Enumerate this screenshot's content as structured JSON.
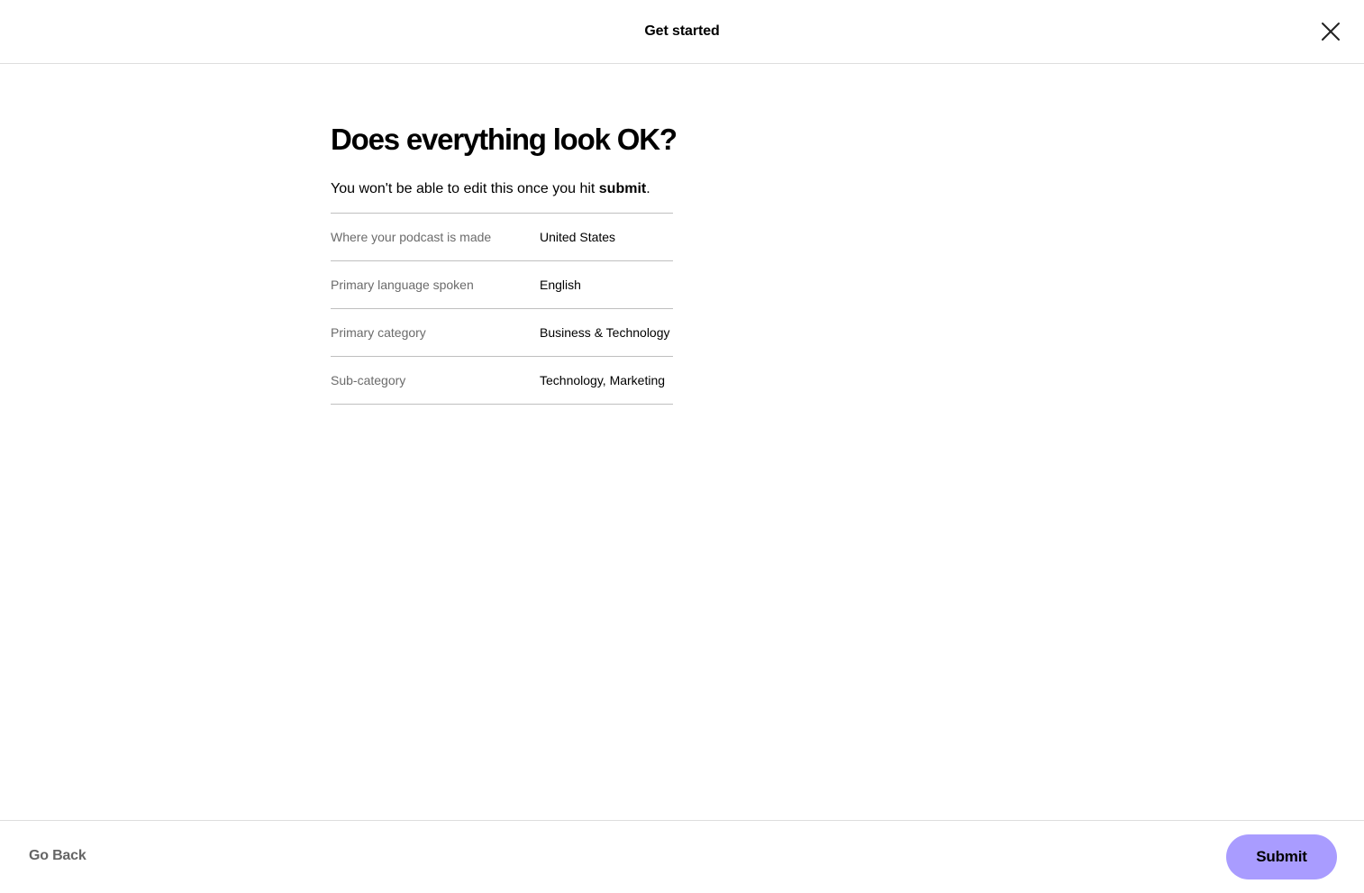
{
  "header": {
    "title": "Get started",
    "close_icon": "close-icon"
  },
  "main": {
    "title": "Does everything look OK?",
    "subtitle_prefix": "You won't be able to edit this once you hit ",
    "subtitle_bold": "submit",
    "subtitle_suffix": ".",
    "rows": [
      {
        "label": "Where your podcast is made",
        "value": "United States"
      },
      {
        "label": "Primary language spoken",
        "value": "English"
      },
      {
        "label": "Primary category",
        "value": "Business & Technology"
      },
      {
        "label": "Sub-category",
        "value": "Technology, Marketing"
      }
    ]
  },
  "footer": {
    "back_label": "Go Back",
    "submit_label": "Submit"
  },
  "colors": {
    "accent": "#a99cff",
    "label_text": "#6b6b6b",
    "divider": "#bfbfbf"
  }
}
